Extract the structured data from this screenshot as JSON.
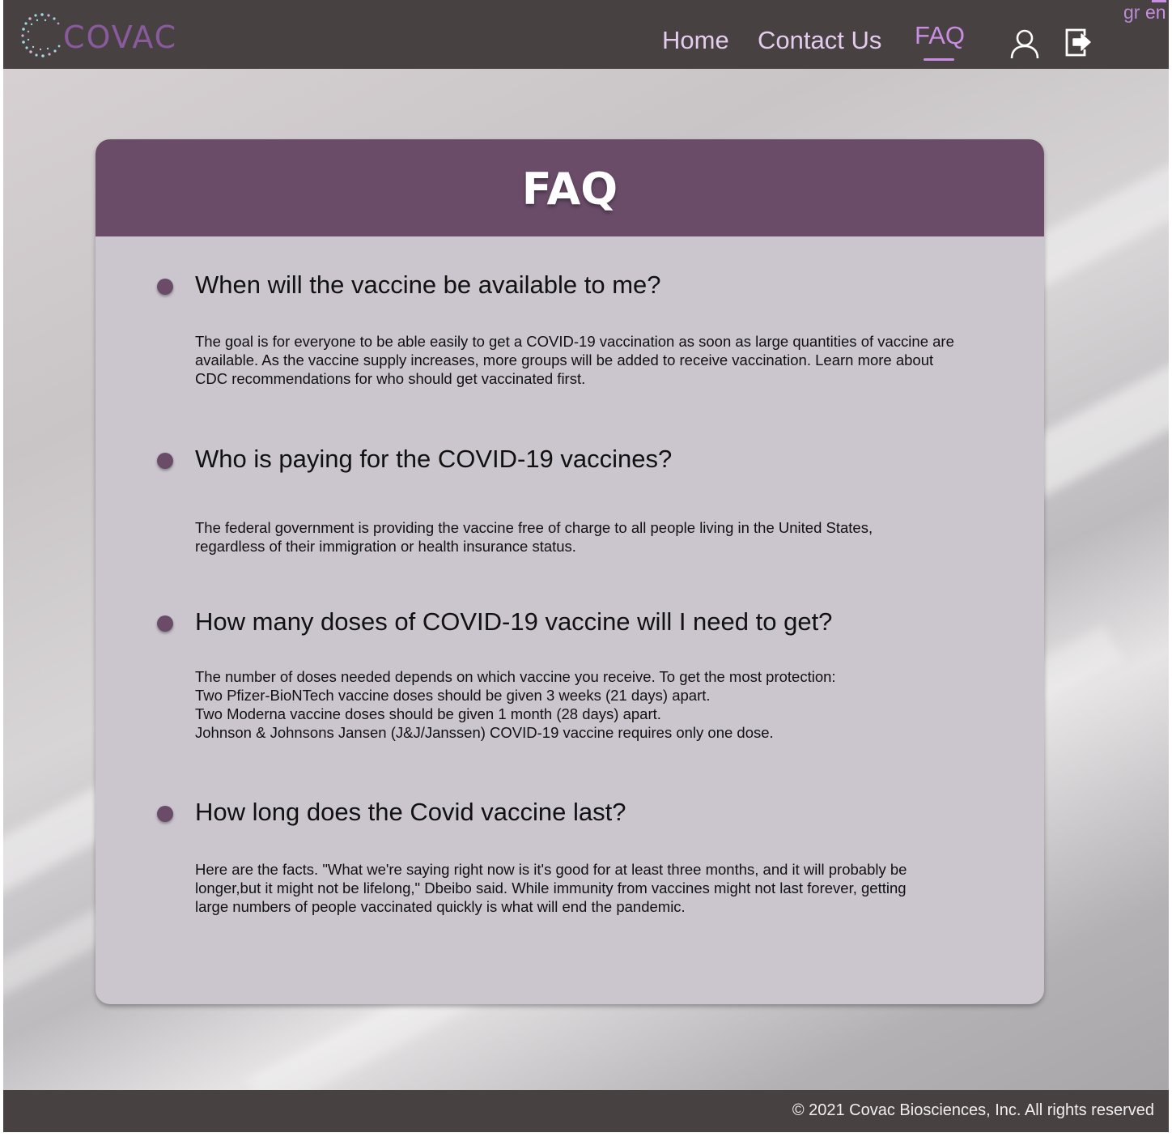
{
  "header": {
    "logo_text": "COVAC",
    "nav": {
      "home": "Home",
      "contact": "Contact Us",
      "faq": "FAQ"
    },
    "languages": {
      "gr": "gr",
      "en": "en"
    },
    "icons": {
      "user": "user-icon",
      "logout": "logout-icon"
    }
  },
  "faq": {
    "title": "FAQ",
    "items": [
      {
        "question": "When will the vaccine be available to me?",
        "answer": [
          "The goal is for everyone to be able easily to get a COVID-19 vaccination as soon as large quantities of vaccine are",
          "available. As the vaccine supply increases, more groups will be added to receive vaccination. Learn more about",
          "CDC recommendations for who should get vaccinated first."
        ]
      },
      {
        "question": "Who is paying for the COVID-19 vaccines?",
        "answer": [
          "The federal government is providing the vaccine free of charge to all people living in the United States,",
          "regardless of their immigration or health insurance status."
        ]
      },
      {
        "question": "How many doses of COVID-19 vaccine will I need to get?",
        "answer": [
          "The number of doses needed depends on which vaccine you receive. To get the most protection:",
          "Two Pfizer-BioNTech vaccine doses should be given 3 weeks (21 days) apart.",
          "Two Moderna vaccine doses should be given 1 month (28 days) apart.",
          "Johnson & Johnsons Jansen (J&J/Janssen) COVID-19 vaccine requires only one dose."
        ]
      },
      {
        "question": "How long does the Covid vaccine last?",
        "answer": [
          "Here are the facts. \"What we're saying right now is it's good for at least three months, and it will probably be",
          "longer,but it might not be lifelong,\" Dbeibo said. While immunity from vaccines might not last forever, getting",
          "large numbers of people vaccinated quickly is what will end the pandemic."
        ]
      }
    ]
  },
  "footer": {
    "copyright": "© 2021 Covac Biosciences, Inc. All rights reserved"
  },
  "colors": {
    "header_bg": "#474141",
    "accent": "#c98de3",
    "card_header": "#6a4c69",
    "card_body": "#cbc5ce"
  }
}
